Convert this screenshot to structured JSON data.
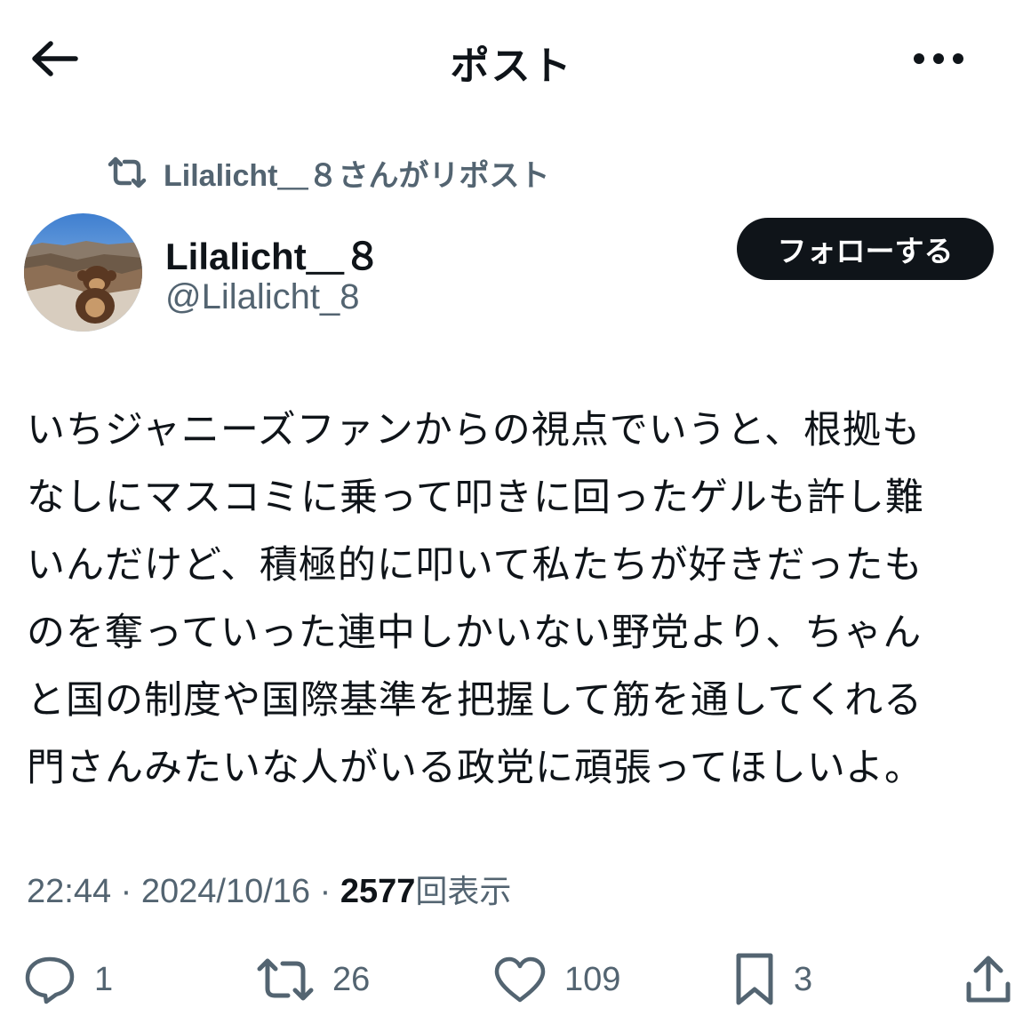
{
  "header": {
    "title": "ポスト",
    "icons": {
      "back": "arrow-left-icon",
      "more": "more-horizontal-icon"
    }
  },
  "repost_indicator": {
    "icon": "repost-icon",
    "text": "Lilalicht＿８さんがリポスト"
  },
  "author": {
    "avatar": "avatar-photo",
    "display_name": "Lilalicht＿８",
    "handle": "@Lilalicht_8",
    "follow_label": "フォローする"
  },
  "tweet": {
    "text": "いちジャニーズファンからの視点でいうと、根拠も\nなしにマスコミに乗って叩きに回ったゲルも許し難\nいんだけど、積極的に叩いて私たちが好きだったも\nのを奪っていった連中しかいない野党より、ちゃん\nと国の制度や国際基準を把握して筋を通してくれる\n門さんみたいな人がいる政党に頑張ってほしいよ。"
  },
  "meta": {
    "time": "22:44",
    "separator": " · ",
    "date": "2024/10/16",
    "views_count": "2577",
    "views_label": "回表示"
  },
  "actions": {
    "reply": {
      "icon": "reply-icon",
      "count": "1"
    },
    "repost": {
      "icon": "repost-icon",
      "count": "26"
    },
    "like": {
      "icon": "heart-icon",
      "count": "109"
    },
    "bookmark": {
      "icon": "bookmark-icon",
      "count": "3"
    },
    "share": {
      "icon": "share-icon"
    }
  },
  "colors": {
    "text_primary": "#0f1419",
    "text_secondary": "#536471",
    "follow_button_bg": "#0f1419",
    "background": "#ffffff"
  }
}
